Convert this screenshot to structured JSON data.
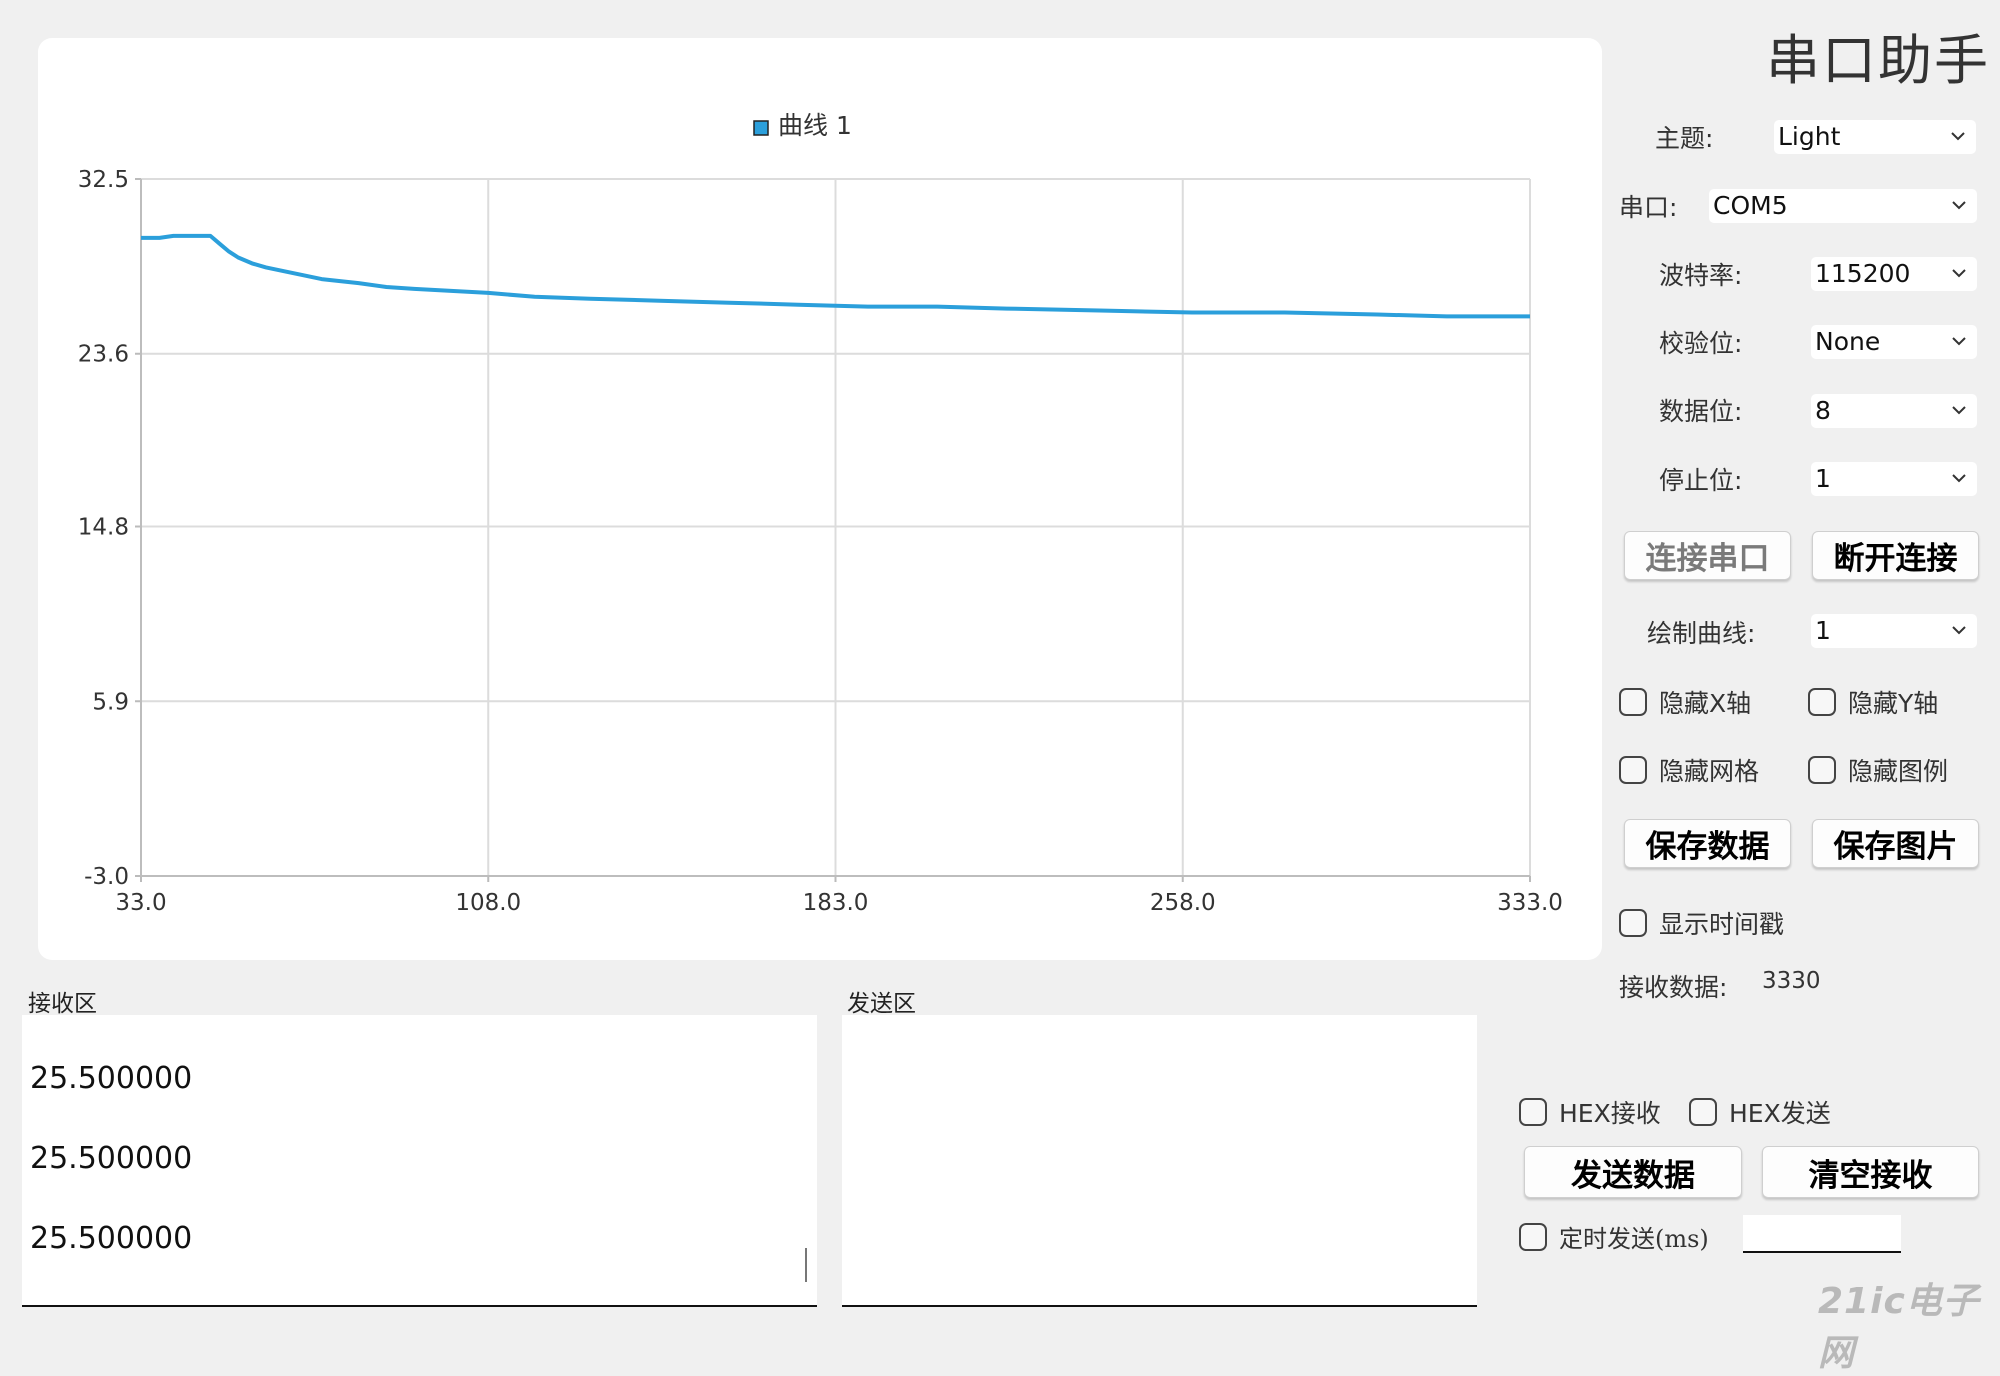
{
  "app": {
    "title": "串口助手"
  },
  "chart_data": {
    "type": "line",
    "legend": [
      "曲线 1"
    ],
    "legend_position": "top-center",
    "grid": true,
    "xlim": [
      33.0,
      333.0
    ],
    "ylim": [
      -3.0,
      32.5
    ],
    "x_ticks": [
      "33.0",
      "108.0",
      "183.0",
      "258.0",
      "333.0"
    ],
    "y_ticks": [
      "32.5",
      "23.6",
      "14.8",
      "5.9",
      "-3.0"
    ],
    "series": [
      {
        "name": "曲线 1",
        "color": "#2b9fdb",
        "x": [
          33,
          37,
          40,
          44,
          48,
          50,
          52,
          54,
          57,
          60,
          64,
          68,
          72,
          76,
          80,
          86,
          92,
          100,
          108,
          118,
          130,
          145,
          160,
          175,
          190,
          205,
          220,
          240,
          260,
          280,
          300,
          315,
          333
        ],
        "y": [
          29.5,
          29.5,
          29.6,
          29.6,
          29.6,
          29.2,
          28.8,
          28.5,
          28.2,
          28.0,
          27.8,
          27.6,
          27.4,
          27.3,
          27.2,
          27.0,
          26.9,
          26.8,
          26.7,
          26.5,
          26.4,
          26.3,
          26.2,
          26.1,
          26.0,
          26.0,
          25.9,
          25.8,
          25.7,
          25.7,
          25.6,
          25.5,
          25.5
        ]
      }
    ]
  },
  "settings": {
    "theme": {
      "label": "主题:",
      "value": "Light"
    },
    "port": {
      "label": "串口:",
      "value": "COM5"
    },
    "baud": {
      "label": "波特率:",
      "value": "115200"
    },
    "parity": {
      "label": "校验位:",
      "value": "None"
    },
    "databits": {
      "label": "数据位:",
      "value": "8"
    },
    "stopbits": {
      "label": "停止位:",
      "value": "1"
    },
    "curves": {
      "label": "绘制曲线:",
      "value": "1"
    }
  },
  "buttons": {
    "connect": "连接串口",
    "disconnect": "断开连接",
    "save_data": "保存数据",
    "save_image": "保存图片",
    "send": "发送数据",
    "clear": "清空接收"
  },
  "checkboxes": {
    "hide_x": "隐藏X轴",
    "hide_y": "隐藏Y轴",
    "hide_grid": "隐藏网格",
    "hide_legend": "隐藏图例",
    "show_timestamp": "显示时间戳",
    "hex_recv": "HEX接收",
    "hex_send": "HEX发送",
    "timed_send": "定时发送(ms)"
  },
  "status": {
    "recv_label": "接收数据:",
    "recv_count": "3330"
  },
  "receive": {
    "label": "接收区",
    "lines": [
      "25.500000",
      "25.500000",
      "25.500000"
    ]
  },
  "send": {
    "label": "发送区",
    "text": ""
  },
  "timer": {
    "value": ""
  },
  "watermark": "21ic电子网"
}
